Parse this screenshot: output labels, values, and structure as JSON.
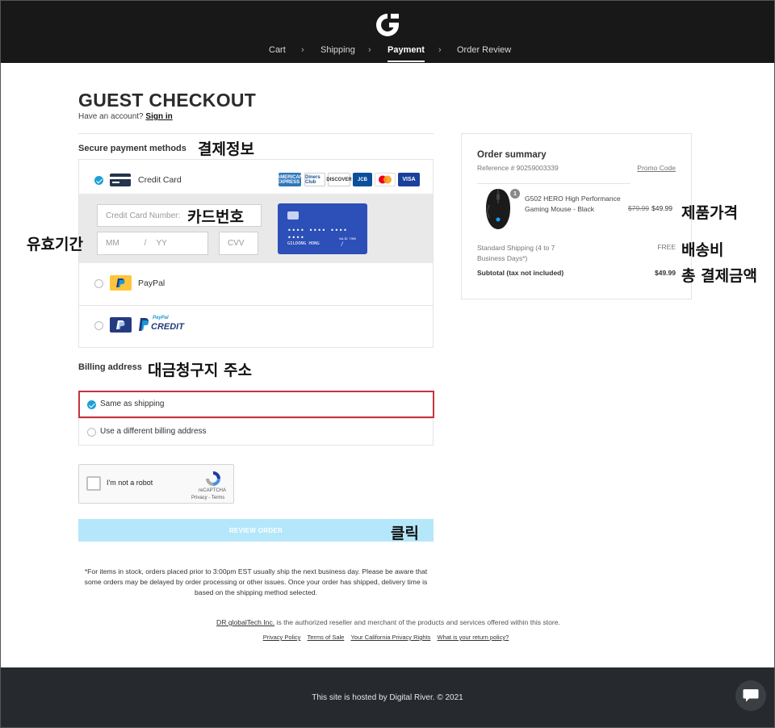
{
  "header": {
    "steps": [
      "Cart",
      "Shipping",
      "Payment",
      "Order Review"
    ],
    "active_step": "Payment"
  },
  "page": {
    "title": "GUEST CHECKOUT",
    "have_account": "Have an account?",
    "sign_in": "Sign in"
  },
  "payment": {
    "section_label": "Secure payment methods",
    "options": {
      "credit_card": "Credit Card",
      "paypal": "PayPal",
      "paypal_credit_top": "PayPal",
      "paypal_credit_bottom": "CREDIT"
    },
    "brands": [
      "AMERICAN EXPRESS",
      "Diners Club",
      "DISCOVER",
      "JCB",
      "Mastercard",
      "VISA"
    ],
    "card_number_placeholder": "Credit Card Number:",
    "exp_month_placeholder": "MM",
    "exp_sep": "/",
    "exp_year_placeholder": "YY",
    "cvv_placeholder": "CVV",
    "card_preview": {
      "number": "•••• •••• •••• ••••",
      "holder": "GILDONG HONG",
      "valid_label": "VALID THRU",
      "valid_value": "/"
    }
  },
  "billing": {
    "section_label": "Billing address",
    "same_as_shipping": "Same as shipping",
    "different": "Use a different billing address"
  },
  "captcha": {
    "label": "I'm not a robot",
    "brand": "reCAPTCHA",
    "links": "Privacy - Terms"
  },
  "review_button": "REVIEW ORDER",
  "note": "*For items in stock, orders placed prior to 3:00pm EST usually ship the next business day. Please be aware that some orders may be delayed by order processing or other issues. Once your order has shipped, delivery time is based on the shipping method selected.",
  "legal": {
    "company": "DR globalTech Inc.",
    "text": " is the authorized reseller and merchant of the products and services offered within this store."
  },
  "legal_links": [
    "Privacy Policy",
    "Terms of Sale",
    "Your California Privacy Rights",
    "What is your return policy?"
  ],
  "footer": {
    "text": "This site is hosted by Digital River. © 2021"
  },
  "summary": {
    "title": "Order summary",
    "reference": "Reference # 90259003339",
    "promo": "Promo Code",
    "item": {
      "qty": "1",
      "name": "G502 HERO High Performance Gaming Mouse - Black",
      "price_old": "$79.99",
      "price_new": "$49.99"
    },
    "shipping_label": "Standard Shipping (4 to 7 Business Days*)",
    "shipping_value": "FREE",
    "subtotal_label": "Subtotal (tax not included)",
    "subtotal_value": "$49.99"
  },
  "annotations": {
    "payment_info": "결제정보",
    "card_number": "카드번호",
    "expiry": "유효기간",
    "billing_addr": "대금청구지 주소",
    "click": "클릭",
    "product_price": "제품가격",
    "shipping_fee": "배송비",
    "total": "총 결제금액"
  },
  "colors": {
    "header_bg": "#181818",
    "accent": "#1ca0d6",
    "review_button_bg": "#b5e7fb",
    "highlight_border": "#c8323c",
    "footer_bg": "#262a2e",
    "card_preview_bg": "#2d4fb8"
  }
}
